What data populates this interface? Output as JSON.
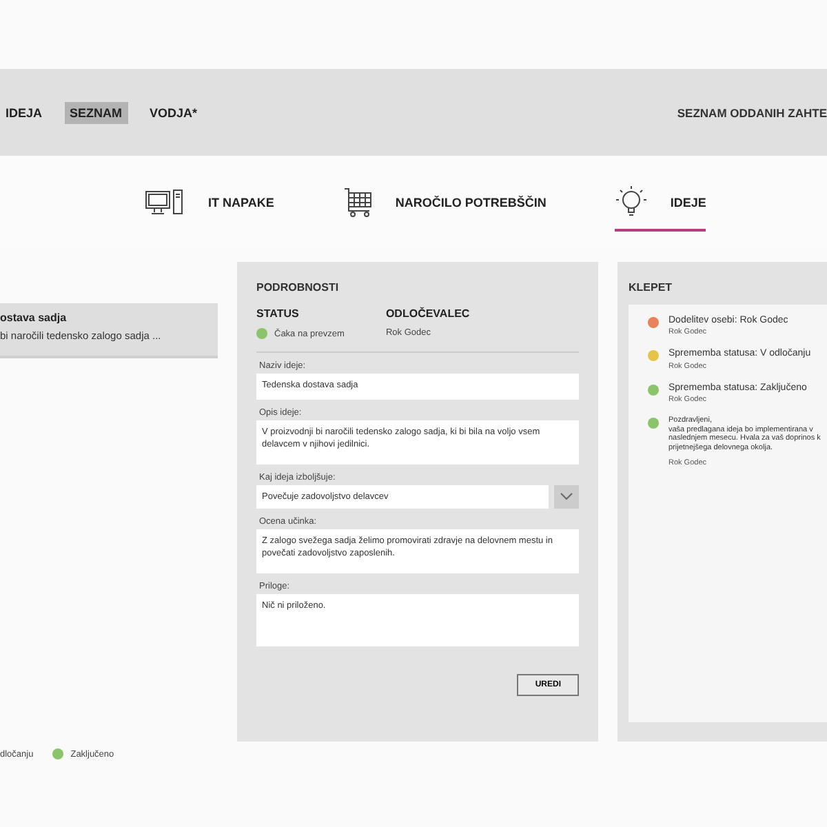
{
  "nav": {
    "items": [
      {
        "label": "IDEJA",
        "selected": false
      },
      {
        "label": "SEZNAM",
        "selected": true
      },
      {
        "label": "VODJA*",
        "selected": false
      }
    ],
    "right_link": "SEZNAM ODDANIH ZAHTE"
  },
  "categories": [
    {
      "kind": "computer",
      "label": "IT NAPAKE",
      "selected": false
    },
    {
      "kind": "cart",
      "label": "NAROČILO POTREBŠČIN",
      "selected": false
    },
    {
      "kind": "bulb",
      "label": "IDEJE",
      "selected": true
    }
  ],
  "list": [
    {
      "title": "ostava sadja",
      "summary": "bi naročili tedensko zalogo sadja ...",
      "selected": true
    }
  ],
  "details": {
    "heading": "PODROBNOSTI",
    "status_label": "STATUS",
    "status": {
      "text": "Čaka na prevzem",
      "color": "#8cc46a"
    },
    "decider_label": "ODLOČEVALEC",
    "decider": "Rok Godec",
    "fields": [
      {
        "kind": "text",
        "label": "Naziv ideje:",
        "value": "Tedenska dostava sadja"
      },
      {
        "kind": "area",
        "label": "Opis ideje:",
        "value": "V proizvodnji bi naročili tedensko zalogo sadja, ki bi bila na voljo vsem delavcem v njihovi jedilnici."
      },
      {
        "kind": "select",
        "label": "Kaj ideja izboljšuje:",
        "value": "Povečuje zadovoljstvo delavcev"
      },
      {
        "kind": "area",
        "label": "Ocena učinka:",
        "value": "Z zalogo svežega sadja želimo promovirati zdravje na delovnem mestu in povečati zadovoljstvo zaposlenih."
      },
      {
        "kind": "tall",
        "label": "Priloge:",
        "value": "Nič ni priloženo."
      }
    ],
    "button": "UREDI"
  },
  "chat": {
    "heading": "KLEPET",
    "messages": [
      {
        "text": "Dodelitev osebi: Rok Godec",
        "author": "Rok Godec",
        "color": "#e8825a",
        "kind": "event"
      },
      {
        "text": "Sprememba statusa: V odločanju",
        "author": "Rok Godec",
        "color": "#e6c44a",
        "kind": "event"
      },
      {
        "text": "Sprememba statusa: Zaključeno",
        "author": "Rok Godec",
        "color": "#8cc46a",
        "kind": "event"
      },
      {
        "text": "Pozdravljeni,\nvaša predlagana ideja bo implementirana v\nnaslednjem mesecu. Hvala za vaš doprinos k\nprijetnejšega delovnega okolja.",
        "author": "Rok Godec",
        "color": "#8cc46a",
        "kind": "message"
      }
    ]
  },
  "legend": [
    {
      "label": "dločanju"
    },
    {
      "label": "Zaključeno",
      "color": "#8cc46a"
    }
  ]
}
